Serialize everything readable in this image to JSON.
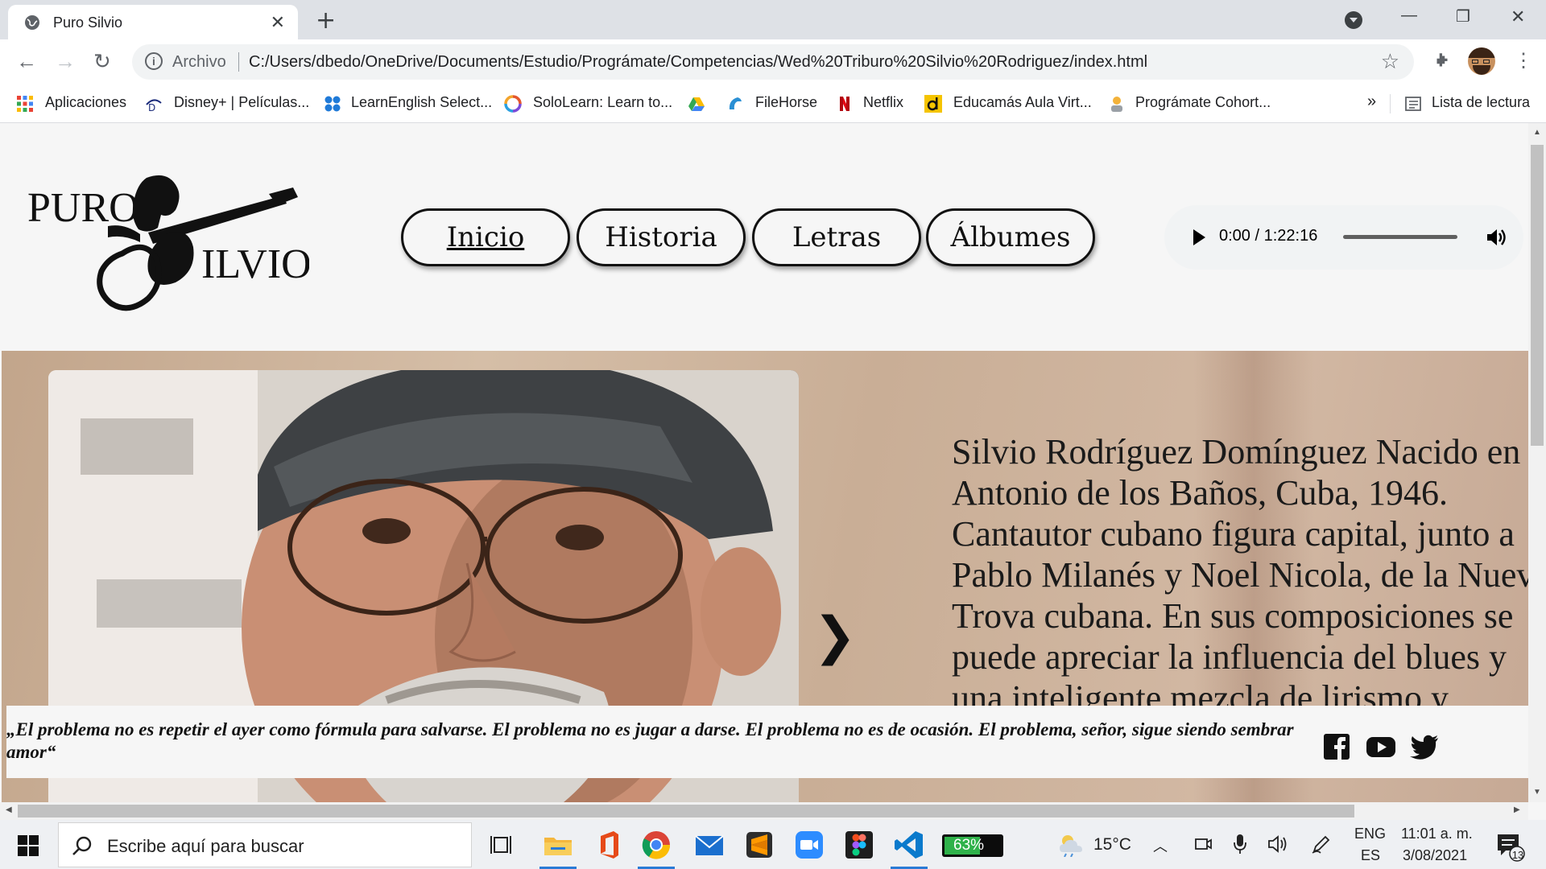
{
  "browser": {
    "tab_title": "Puro Silvio",
    "url_label": "Archivo",
    "url": "C:/Users/dbedo/OneDrive/Documents/Estudio/Prográmate/Competencias/Wed%20Triburo%20Silvio%20Rodriguez/index.html"
  },
  "bookmarks": {
    "items": [
      "Aplicaciones",
      "Disney+ | Películas...",
      "LearnEnglish Select...",
      "SoloLearn: Learn to...",
      "FileHorse",
      "Netflix",
      "Educamás Aula Virt...",
      "Prográmate Cohort..."
    ],
    "overflow": "»",
    "reading_list": "Lista de lectura"
  },
  "site": {
    "logo_line1": "PURO",
    "logo_line2": "ILVIO",
    "nav": [
      "Inicio",
      "Historia",
      "Letras",
      "Álbumes"
    ],
    "audio_time": "0:00 / 1:22:16",
    "hero_text": "Silvio Rodríguez Domínguez Nacido en Antonio de los Baños, Cuba, 1946. Cantautor cubano figura capital, junto a Pablo Milanés y Noel Nicola, de la Nueva Trova cubana. En sus composiciones se puede apreciar la influencia del blues y una inteligente mezcla de lirismo y compromiso social, aunque sin caer en",
    "quote": "„El problema no es repetir el ayer como fórmula para salvarse. El problema no es jugar a darse. El problema no es de ocasión. El problema, señor, sigue siendo sembrar amor“"
  },
  "taskbar": {
    "search_placeholder": "Escribe aquí para buscar",
    "battery": "63%",
    "battery_level": 0.63,
    "temperature": "15°C",
    "lang_1": "ENG",
    "lang_2": "ES",
    "time": "11:01 a. m.",
    "date": "3/08/2021",
    "notifications": "13"
  }
}
